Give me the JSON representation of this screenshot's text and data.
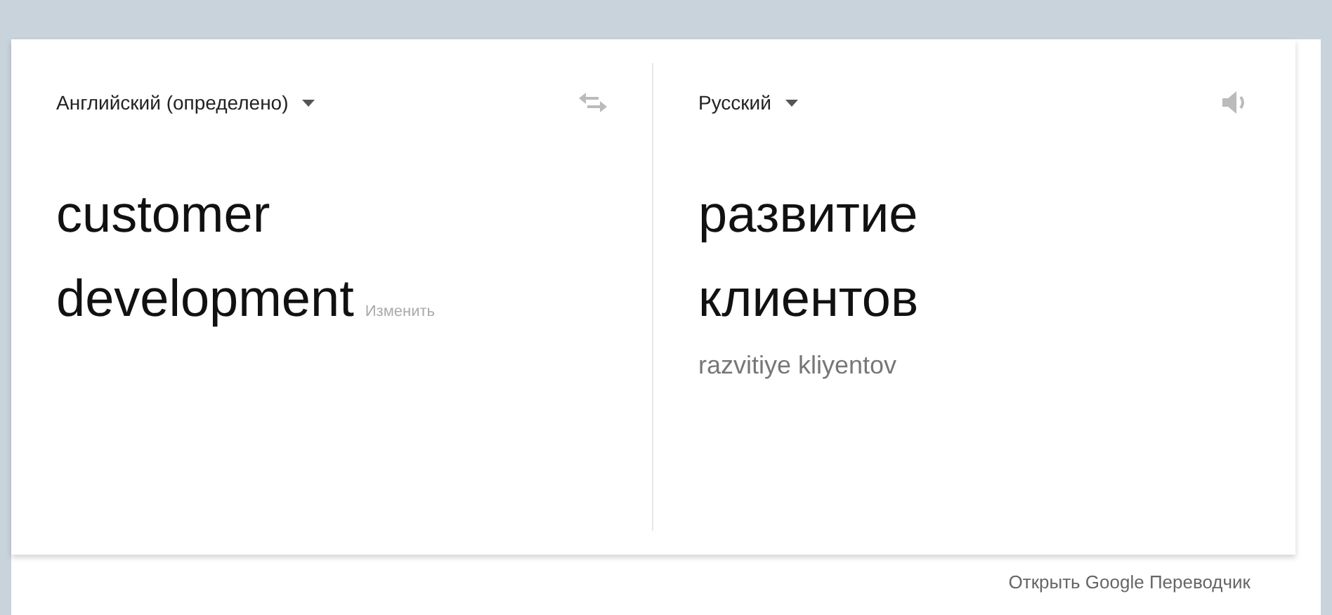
{
  "source": {
    "language": "Английский (определено)",
    "text_lines": [
      "customer",
      "development"
    ],
    "edit_link": "Изменить"
  },
  "target": {
    "language": "Русский",
    "text_lines": [
      "развитие",
      "клиентов"
    ],
    "transliteration": "razvitiye kliyentov"
  },
  "footer_link": "Открыть Google Переводчик"
}
